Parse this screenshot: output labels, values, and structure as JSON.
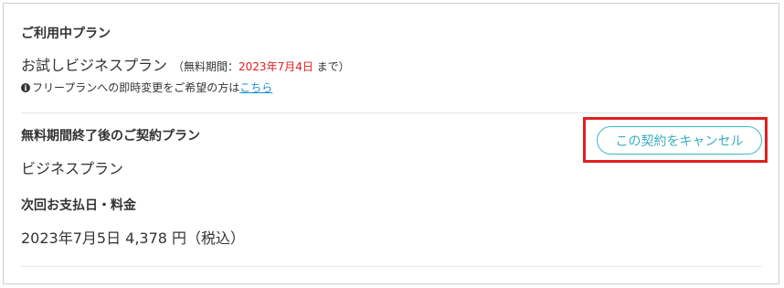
{
  "current_plan": {
    "heading": "ご利用中プラン",
    "name": "お試しビジネスプラン",
    "trial_prefix": "（無料期間：",
    "trial_date": "2023年7月4日",
    "trial_suffix": " まで）",
    "info_icon_glyph": "i",
    "info_text": "フリープランへの即時変更をご希望の方は",
    "info_link": "こちら"
  },
  "after_trial": {
    "heading": "無料期間終了後のご契約プラン",
    "plan_name": "ビジネスプラン",
    "cancel_button": "この契約をキャンセル"
  },
  "next_payment": {
    "heading": "次回お支払日・料金",
    "value": "2023年7月5日 4,378 円（税込）"
  },
  "colors": {
    "accent": "#3fb7c9",
    "highlight": "#e02020",
    "date_red": "#e02020",
    "link": "#1a8fd6"
  }
}
